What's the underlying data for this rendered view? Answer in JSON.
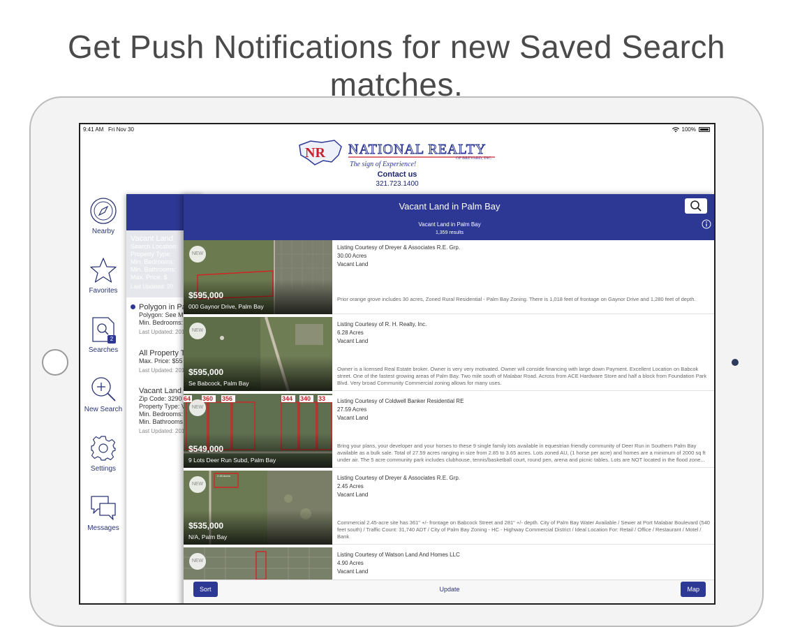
{
  "headline": "Get Push Notifications for new Saved Search matches.",
  "status_bar": {
    "time": "9:41 AM",
    "date": "Fri Nov 30",
    "battery": "100%"
  },
  "brand": {
    "logo_initials": "NR",
    "logo_name": "NATIONAL REALTY",
    "logo_sub": "OF BREVARD, INC.",
    "logo_tagline": "The sign of Experience!",
    "contact_label": "Contact us",
    "phone": "321.723.1400"
  },
  "sidebar": {
    "items": [
      {
        "label": "Nearby",
        "icon": "compass-icon"
      },
      {
        "label": "Favorites",
        "icon": "star-icon"
      },
      {
        "label": "Searches",
        "icon": "saved-searches-icon",
        "badge": "2"
      },
      {
        "label": "New Search",
        "icon": "zoom-in-icon"
      },
      {
        "label": "Settings",
        "icon": "gear-icon"
      },
      {
        "label": "Messages",
        "icon": "chat-icon"
      }
    ]
  },
  "saved_searches": [
    {
      "title": "Vacant Land",
      "lines": [
        "Search Location:",
        "Property Type:",
        "Min. Bedrooms:",
        "Min. Bathrooms:",
        "Max. Price: $"
      ],
      "updated": "Last Updated: 20"
    },
    {
      "title": "Polygon in Pa",
      "lines": [
        "Polygon: See M",
        "Min. Bedrooms:"
      ],
      "updated": "Last Updated: 201"
    },
    {
      "title": "All Property T",
      "lines": [
        "Max. Price: $55"
      ],
      "updated": "Last Updated: 201"
    },
    {
      "title": "Vacant Land",
      "lines": [
        "Zip Code: 3290",
        "Property Type: V",
        "Min. Bedrooms:",
        "Min. Bathrooms"
      ],
      "updated": "Last Updated: 201"
    }
  ],
  "results": {
    "title": "Vacant Land in Palm Bay",
    "subtitle": "Vacant Land in Palm Bay",
    "count": "1,359 results"
  },
  "listings": [
    {
      "new_label": "NEW",
      "price": "$595,000",
      "address": "000 Gaynor Drive, Palm Bay",
      "courtesy": "Listing Courtesy of Dreyer & Associates R.E. Grp.",
      "acres": "30.00 Acres",
      "type": "Vacant Land",
      "description": "Prior orange grove includes 30 acres, Zoned Rural Residential - Palm Bay Zoning. There is 1,018 feet of frontage on Gaynor Drive and 1,280 feet of depth."
    },
    {
      "new_label": "NEW",
      "price": "$595,000",
      "address": "Se Babcock, Palm Bay",
      "courtesy": "Listing Courtesy of R. H. Realty, Inc.",
      "acres": "6.28 Acres",
      "type": "Vacant Land",
      "description": "Owner is a licensed Real Estate broker. Owner is very very motivated. Owner will conside financing with large down Payment. Excellent Location on Babcok street. One of the fastest growing areas of Palm Bay. Two mile south of Malabar Road. Across from ACE Hardware Store and half a block from Foundation Park Blvd. Very broad Community Commercial zoning allows for many uses."
    },
    {
      "new_label": "NEW",
      "price": "$549,000",
      "address": "9 Lots Deer Run Subd, Palm Bay",
      "courtesy": "Listing Courtesy of Coldwell Banker Residential RE",
      "acres": "27.59 Acres",
      "type": "Vacant Land",
      "description": "Bring your plans, your developer and your horses to these 9 single family lots available in equestrian friendly community of Deer Run in Southern Palm Bay available as a bulk sale. Total of 27.59 acres ranging in size from 2.85 to 3.65 acres. Lots zoned AU, (1 horse per acre) and homes are a minimum of 2000 sq ft under air. The 5 acre community park includes clubhouse, tennis/basketball court, round pen, arena and picnic tables. Lots are NOT located in the flood zone...",
      "lot_labels": [
        "64",
        "360",
        "356",
        "344",
        "340",
        "33"
      ]
    },
    {
      "new_label": "NEW",
      "price": "$535,000",
      "address": "N/A, Palm Bay",
      "courtesy": "Listing Courtesy of Dreyer & Associates R.E. Grp.",
      "acres": "2.45 Acres",
      "type": "Vacant Land",
      "description": "Commercial 2.45-acre site has 361\" +/- frontage on Babcock Street and 281\" +/- depth. City of Palm Bay Water Available / Sewer at Port Malabar Boulevard (540 feet south) / Traffic Count: 31,740 ADT / City of Palm Bay Zoning - HC - Highway Commercial District / Ideal Location For: Retail / Office / Restaurant / Motel / Bank",
      "photo_label": "2.45 Acres"
    },
    {
      "new_label": "NEW",
      "price": "",
      "address": "",
      "courtesy": "Listing Courtesy of Watson Land And Homes LLC",
      "acres": "4.90 Acres",
      "type": "Vacant Land",
      "description": ""
    }
  ],
  "toolbar": {
    "sort_label": "Sort",
    "update_label": "Update",
    "map_label": "Map"
  },
  "colors": {
    "brand_blue": "#2c3894",
    "brand_red": "#c8202a",
    "nav_text": "#2a3575"
  }
}
